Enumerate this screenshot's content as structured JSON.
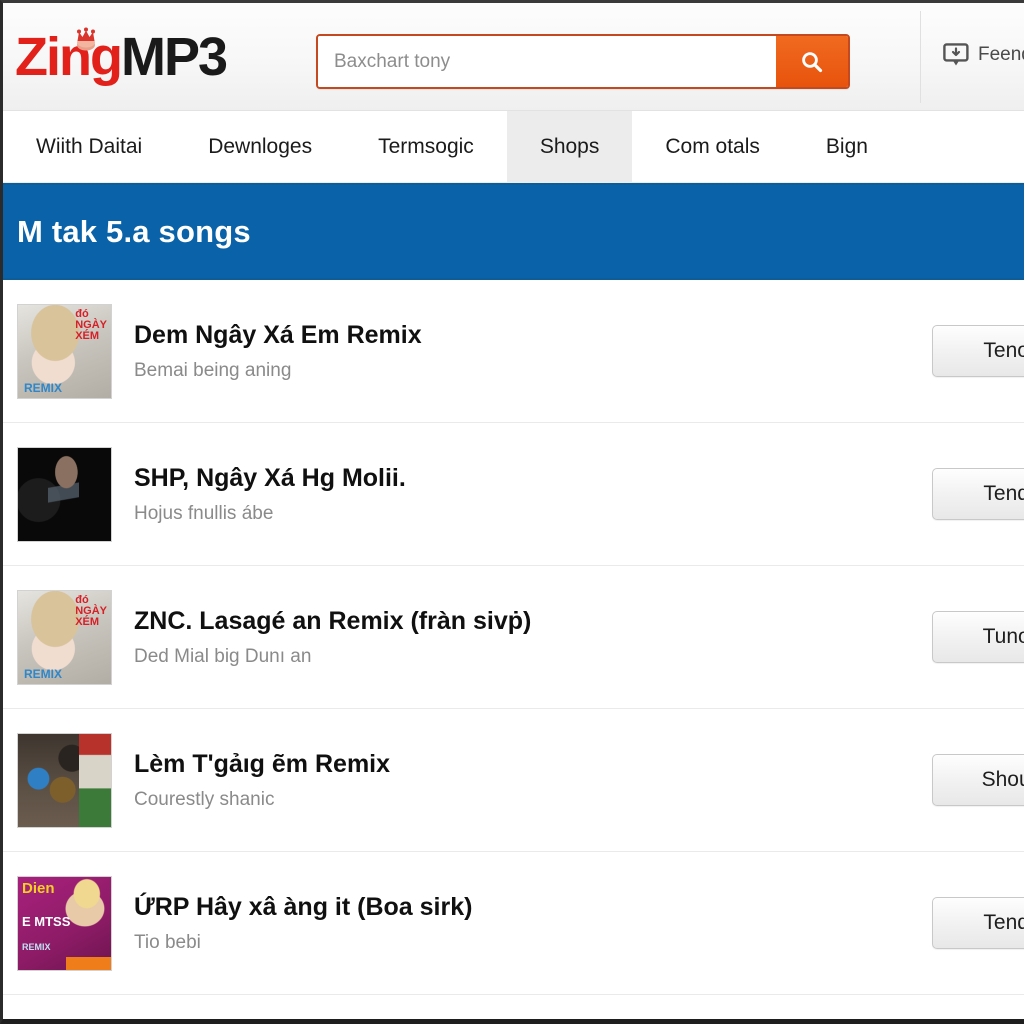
{
  "header": {
    "logo": {
      "part1": "Zing",
      "part2": "MP3",
      "ornament_icon": "crown-icon"
    },
    "search": {
      "placeholder": "Baxchart tony",
      "value": "",
      "button_icon": "search-icon"
    },
    "feedback": {
      "label": "Feend",
      "icon": "feedback-bubble-icon"
    }
  },
  "nav": {
    "items": [
      {
        "label": "Wiith Daitai",
        "active": false
      },
      {
        "label": "Dewnloges",
        "active": false
      },
      {
        "label": "Termsogic",
        "active": false
      },
      {
        "label": "Shops",
        "active": true
      },
      {
        "label": "Com otals",
        "active": false
      },
      {
        "label": "Bign",
        "active": false
      }
    ]
  },
  "banner": {
    "title": "M tak 5.a songs",
    "color": "#0a63a8"
  },
  "songs": [
    {
      "title": "Dem Ngây Xá Em Remix",
      "subtitle": "Bemai being aning",
      "action": "Tenou",
      "thumb": {
        "name": "album-art-hat-girl",
        "bg": "#cfd2d0",
        "accent": "#d61f26",
        "footer": "#2f86c8"
      }
    },
    {
      "title": "SHP, Ngây Xá Hg Molii.",
      "subtitle": "Hojus fnullis ábe",
      "action": "Tendu",
      "thumb": {
        "name": "album-art-dark-stage",
        "bg": "#0a0a0a",
        "accent": "#8fa0b4",
        "footer": "#101010"
      }
    },
    {
      "title": "ZNC. Lasagé an Remix (fràn sivṗ)",
      "subtitle": "Ded Mial big Dunı an",
      "action": "Tunou",
      "thumb": {
        "name": "album-art-hat-girl",
        "bg": "#cfd2d0",
        "accent": "#d61f26",
        "footer": "#2f86c8"
      }
    },
    {
      "title": "Lèm T'gảıg ẽm Remix",
      "subtitle": "Courestly shanic",
      "action": "Shoup",
      "thumb": {
        "name": "album-art-street-group",
        "bg": "#4a4038",
        "accent": "#b6322a",
        "footer": "#2a2724"
      }
    },
    {
      "title": "ỨRP Hây xâ àng it (Boa sirk)",
      "subtitle": "Tio bebi",
      "action": "Tenda",
      "thumb": {
        "name": "album-art-magenta-poster",
        "bg": "#9c1f72",
        "accent": "#f2d022",
        "footer": "#ef7d1a"
      }
    }
  ]
}
